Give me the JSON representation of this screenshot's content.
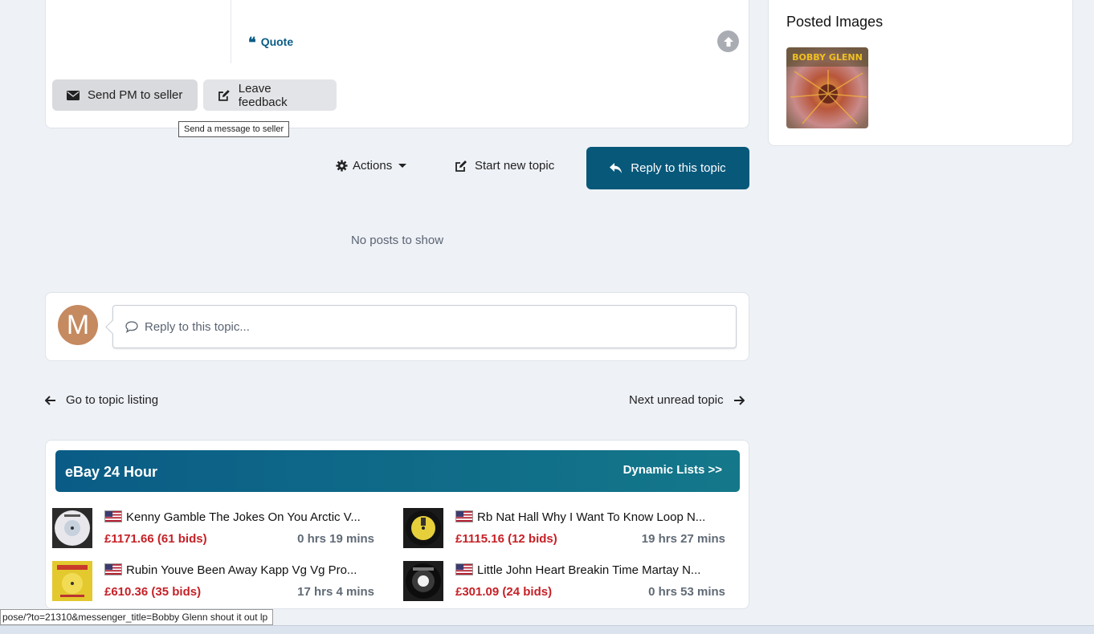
{
  "post": {
    "quote_label": "Quote",
    "pm_button": "Send PM to seller",
    "feedback_button": "Leave feedback",
    "tooltip": "Send a message to seller"
  },
  "toolbar": {
    "actions_label": "Actions",
    "new_topic_label": "Start new topic",
    "reply_label": "Reply to this topic"
  },
  "no_posts": "No posts to show",
  "reply_box": {
    "avatar_letter": "M",
    "placeholder": "Reply to this topic..."
  },
  "nav": {
    "go_to_listing": "Go to topic listing",
    "next_unread": "Next unread topic"
  },
  "ebay": {
    "title": "eBay 24 Hour",
    "dynamic_link": "Dynamic Lists >>",
    "listings": [
      {
        "title": "Kenny Gamble The Jokes On You Arctic V...",
        "price": "£1171.66 (61 bids)",
        "time": "0 hrs 19 mins"
      },
      {
        "title": "Rb Nat Hall Why I Want To Know Loop N...",
        "price": "£1115.16 (12 bids)",
        "time": "19 hrs 27 mins"
      },
      {
        "title": "Rubin Youve Been Away Kapp Vg Vg Pro...",
        "price": "£610.36 (35 bids)",
        "time": "17 hrs 4 mins"
      },
      {
        "title": "Little John Heart Breakin Time Martay N...",
        "price": "£301.09 (24 bids)",
        "time": "0 hrs 53 mins"
      }
    ]
  },
  "sidebar": {
    "title": "Posted Images",
    "image_text": "BOBBY GLENN"
  },
  "status_bar": {
    "url": "pose/?to=21310&messenger_title=Bobby Glenn shout it out lp"
  },
  "colors": {
    "accent": "#08587a",
    "price": "#c62127",
    "background": "#eef1f6"
  }
}
